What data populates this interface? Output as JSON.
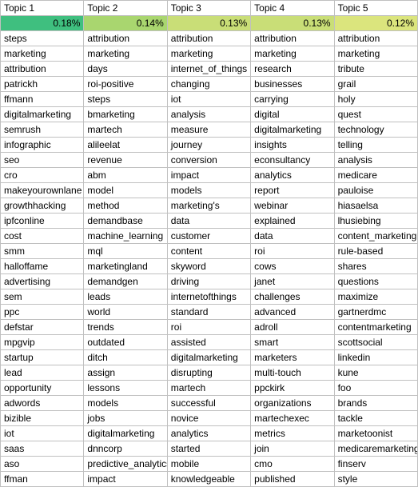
{
  "chart_data": {
    "type": "table",
    "title": "",
    "columns": [
      "Topic 1",
      "Topic 2",
      "Topic 3",
      "Topic 4",
      "Topic 5"
    ],
    "percent_row": {
      "values": [
        "0.18%",
        "0.14%",
        "0.13%",
        "0.13%",
        "0.12%"
      ],
      "colors": [
        "#3fbf7f",
        "#a9d66f",
        "#c9de77",
        "#c9de77",
        "#dbe57d"
      ]
    },
    "rows": [
      [
        "steps",
        "attribution",
        "attribution",
        "attribution",
        "attribution"
      ],
      [
        "marketing",
        "marketing",
        "marketing",
        "marketing",
        "marketing"
      ],
      [
        "attribution",
        "days",
        "internet_of_things",
        "research",
        "tribute"
      ],
      [
        "patrickh",
        "roi-positive",
        "changing",
        "businesses",
        "grail"
      ],
      [
        "ffmann",
        "steps",
        "iot",
        "carrying",
        "holy"
      ],
      [
        "digitalmarketing",
        "bmarketing",
        "analysis",
        "digital",
        "quest"
      ],
      [
        "semrush",
        "martech",
        "measure",
        "digitalmarketing",
        "technology"
      ],
      [
        "infographic",
        "alileelat",
        "journey",
        "insights",
        "telling"
      ],
      [
        "seo",
        "revenue",
        "conversion",
        "econsultancy",
        "analysis"
      ],
      [
        "cro",
        "abm",
        "impact",
        "analytics",
        "medicare"
      ],
      [
        "makeyourownlane",
        "model",
        "models",
        "report",
        "pauloise"
      ],
      [
        "growthhacking",
        "method",
        "marketing's",
        "webinar",
        "hiasaelsa"
      ],
      [
        "ipfconline",
        "demandbase",
        "data",
        "explained",
        "lhusiebing"
      ],
      [
        "cost",
        "machine_learning",
        "customer",
        "data",
        "content_marketing"
      ],
      [
        "smm",
        "mql",
        "content",
        "roi",
        "rule-based"
      ],
      [
        "halloffame",
        "marketingland",
        "skyword",
        "cows",
        "shares"
      ],
      [
        "advertising",
        "demandgen",
        "driving",
        "janet",
        "questions"
      ],
      [
        "sem",
        "leads",
        "internetofthings",
        "challenges",
        "maximize"
      ],
      [
        "ppc",
        "world",
        "standard",
        "advanced",
        "gartnerdmc"
      ],
      [
        "defstar",
        "trends",
        "roi",
        "adroll",
        "contentmarketing"
      ],
      [
        "mpgvip",
        "outdated",
        "assisted",
        "smart",
        "scottsocial"
      ],
      [
        "startup",
        "ditch",
        "digitalmarketing",
        "marketers",
        "linkedin"
      ],
      [
        "lead",
        "assign",
        "disrupting",
        "multi-touch",
        "kune"
      ],
      [
        "opportunity",
        "lessons",
        "martech",
        "ppckirk",
        "foo"
      ],
      [
        "adwords",
        "models",
        "successful",
        "organizations",
        "brands"
      ],
      [
        "bizible",
        "jobs",
        "novice",
        "martechexec",
        "tackle"
      ],
      [
        "iot",
        "digitalmarketing",
        "analytics",
        "metrics",
        "marketoonist"
      ],
      [
        "saas",
        "dnncorp",
        "started",
        "join",
        "medicaremarketing"
      ],
      [
        "aso",
        "predictive_analytics",
        "mobile",
        "cmo",
        "finserv"
      ],
      [
        "ffman",
        "impact",
        "knowledgeable",
        "published",
        "style"
      ]
    ]
  }
}
